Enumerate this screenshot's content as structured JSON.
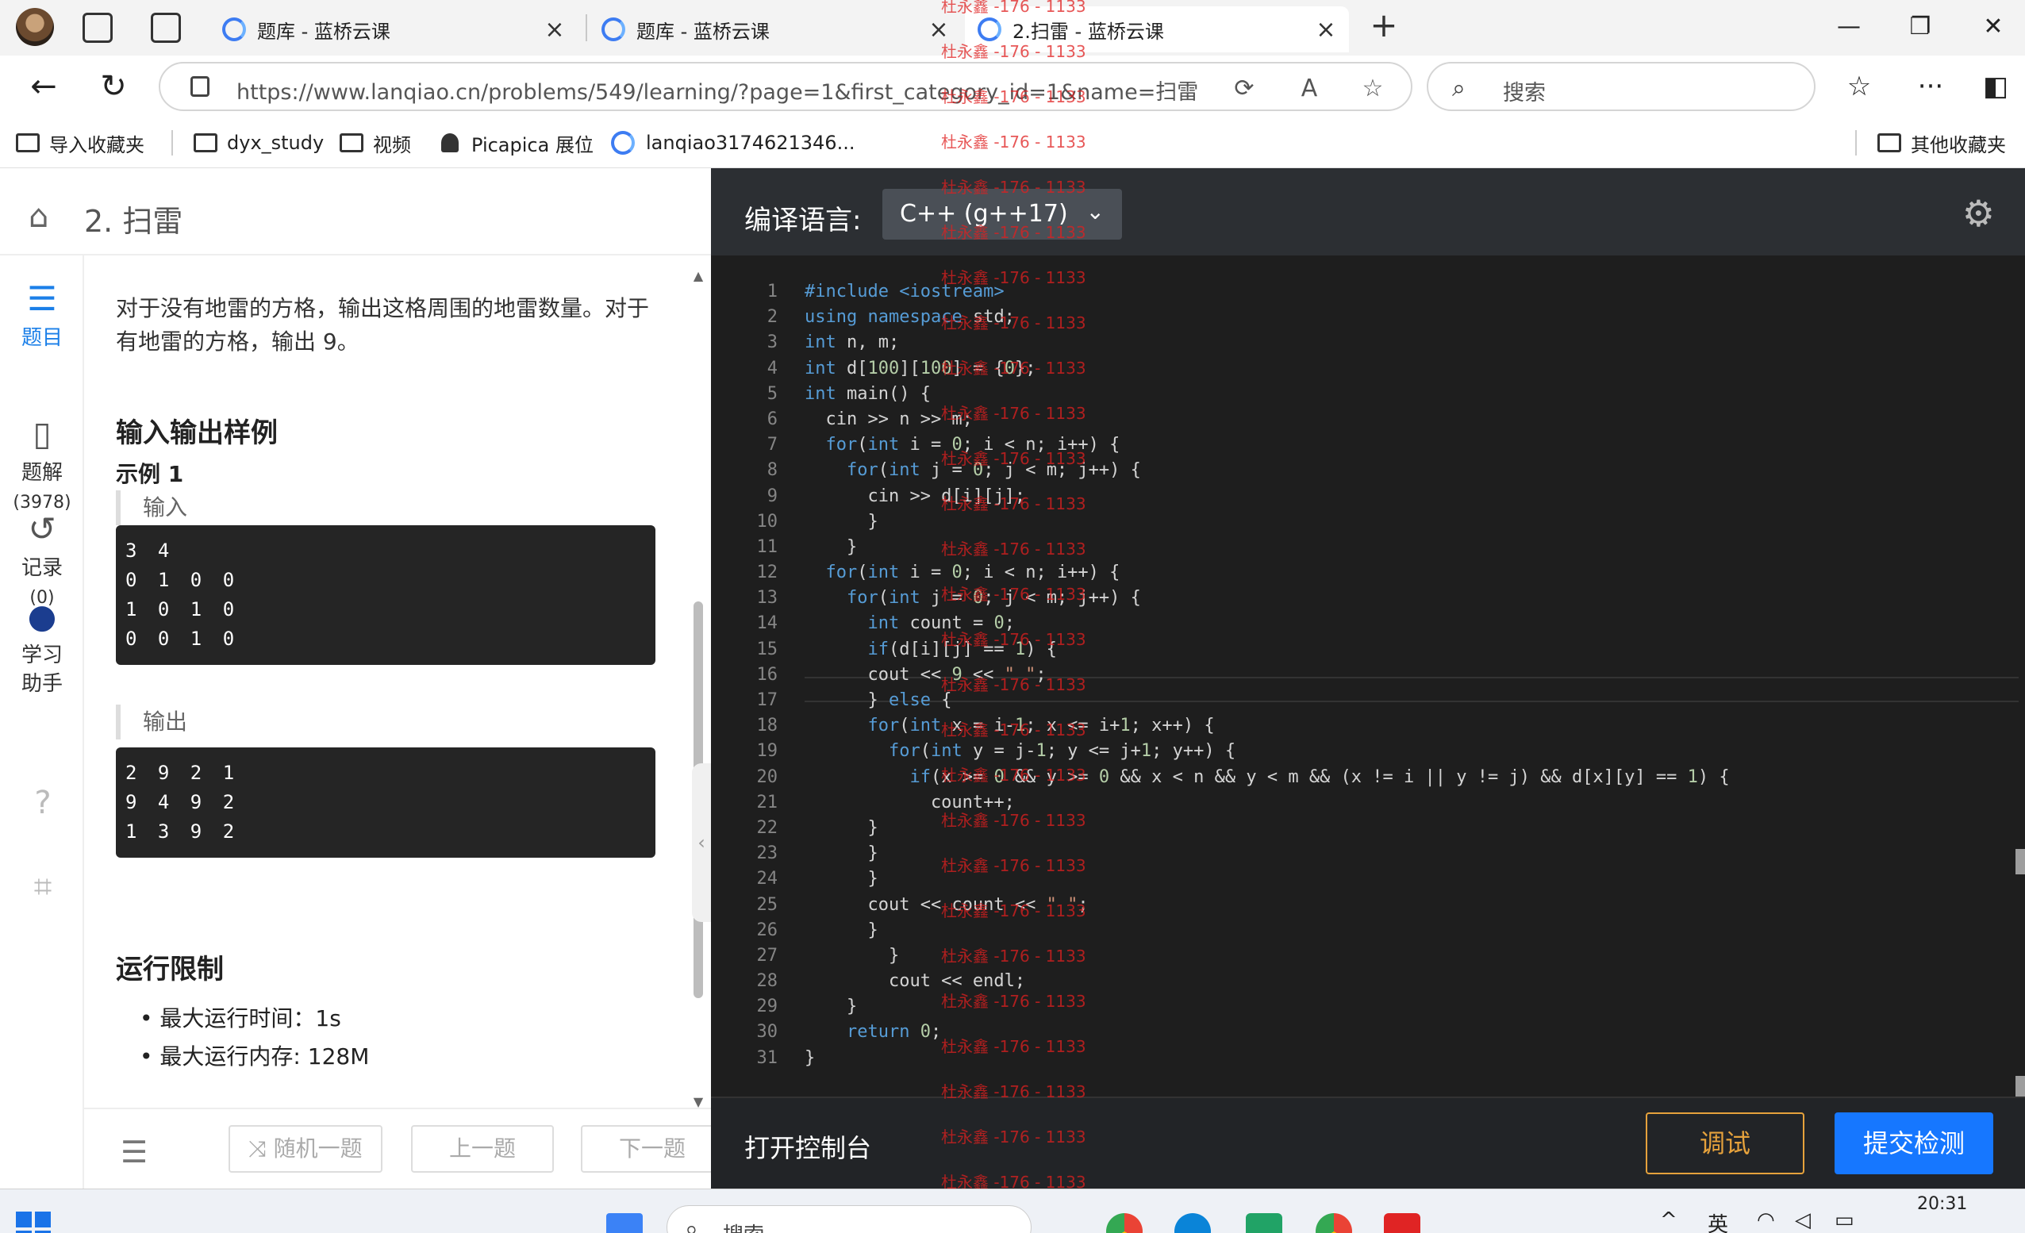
{
  "browser": {
    "tabs": [
      {
        "title": "题库 - 蓝桥云课",
        "active": false
      },
      {
        "title": "题库 - 蓝桥云课",
        "active": false
      },
      {
        "title": "2.扫雷 - 蓝桥云课",
        "active": true
      }
    ],
    "url": "https://www.lanqiao.cn/problems/549/learning/?page=1&first_category_id=1&name=扫雷",
    "search_placeholder": "搜索",
    "bookmarks": [
      {
        "label": "导入收藏夹"
      },
      {
        "label": "dyx_study"
      },
      {
        "label": "视频"
      },
      {
        "label": "Picapica 展位"
      },
      {
        "label": "lanqiao3174621346..."
      }
    ],
    "other_bookmarks": "其他收藏夹"
  },
  "problem": {
    "title": "2. 扫雷",
    "description": "对于没有地雷的方格，输出这格周围的地雷数量。对于有地雷的方格，输出 9。",
    "io_heading": "输入输出样例",
    "example_heading": "示例 1",
    "input_label": "输入",
    "input_lines": [
      "3 4",
      "0 1 0 0",
      "1 0 1 0",
      "0 0 1 0"
    ],
    "output_label": "输出",
    "output_lines": [
      "2 9 2 1",
      "9 4 9 2",
      "1 3 9 2"
    ],
    "limits_heading": "运行限制",
    "limits": [
      "最大运行时间：1s",
      "最大运行内存: 128M"
    ]
  },
  "sidebar": {
    "items": [
      {
        "label": "题目",
        "icon": "list-icon"
      },
      {
        "label": "题解",
        "count": "(3978)",
        "icon": "solution-icon"
      },
      {
        "label": "记录",
        "count": "(0)",
        "icon": "history-icon"
      },
      {
        "label": "学习\n助手",
        "icon": "robot-icon"
      }
    ]
  },
  "footer": {
    "random": "随机一题",
    "prev": "上一题",
    "next": "下一题"
  },
  "editor": {
    "language_label": "编译语言:",
    "language_value": "C++ (g++17)",
    "code": [
      "#include <iostream>",
      "using namespace std;",
      "int n, m;",
      "int d[100][100] = {0};",
      "int main() {",
      "  cin >> n >> m;",
      "  for(int i = 0; i < n; i++) {",
      "    for(int j = 0; j < m; j++) {",
      "      cin >> d[i][j];",
      "      }",
      "    }",
      "  for(int i = 0; i < n; i++) {",
      "    for(int j = 0; j < m; j++) {",
      "      int count = 0;",
      "      if(d[i][j] == 1) {",
      "      cout << 9 << \" \";",
      "      } else {",
      "      for(int x = i-1; x <= i+1; x++) {",
      "        for(int y = j-1; y <= j+1; y++) {",
      "          if(x >= 0 && y >= 0 && x < n && y < m && (x != i || y != j) && d[x][y] == 1) {",
      "            count++;",
      "      }",
      "      }",
      "      }",
      "      cout << count << \" \";",
      "      }",
      "        }",
      "        cout << endl;",
      "    }",
      "    return 0;",
      "}"
    ],
    "console_label": "打开控制台",
    "debug_label": "调试",
    "submit_label": "提交检测"
  },
  "watermark": "杜永鑫 -176 - 1133",
  "taskbar": {
    "search": "搜索",
    "ime": "英",
    "time": "20:31"
  }
}
